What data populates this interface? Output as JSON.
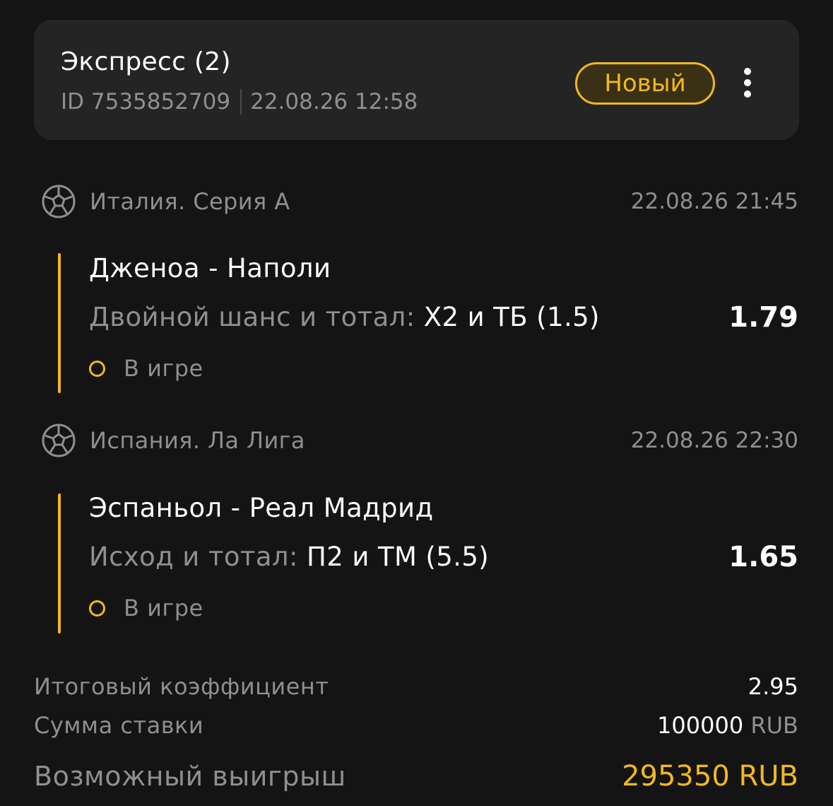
{
  "bet": {
    "title": "Экспресс (2)",
    "id": "ID 7535852709",
    "created": "22.08.26 12:58",
    "status": "Новый"
  },
  "events": [
    {
      "league": "Италия. Серия А",
      "time": "22.08.26 21:45",
      "match": "Дженоа - Наполи",
      "market": "Двойной шанс и тотал:",
      "pick": "Х2 и ТБ (1.5)",
      "odds": "1.79",
      "state": "В игре"
    },
    {
      "league": "Испания. Ла Лига",
      "time": "22.08.26 22:30",
      "match": "Эспаньол - Реал Мадрид",
      "market": "Исход и тотал:",
      "pick": "П2 и ТМ (5.5)",
      "odds": "1.65",
      "state": "В игре"
    }
  ],
  "summary": {
    "total_odds_label": "Итоговый коэффициент",
    "total_odds": "2.95",
    "stake_label": "Сумма ставки",
    "stake_amount": "100000",
    "stake_currency": "RUB",
    "payout_label": "Возможный выигрыш",
    "payout": "295350 RUB"
  },
  "colors": {
    "background": "#141414",
    "card": "#242424",
    "accent": "#f1b81e",
    "muted_text": "#8f8f8f",
    "text": "#ffffff"
  },
  "icons": {
    "sport": "soccer-ball-icon",
    "menu": "more-vertical-icon",
    "state": "status-ring-icon"
  }
}
